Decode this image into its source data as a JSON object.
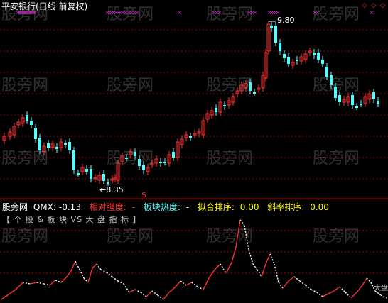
{
  "window": {
    "title": "平安银行(日线 前复权)",
    "controls": [
      "◇",
      "◇",
      "◇"
    ],
    "control_colors": [
      "#ff3333",
      "#ff3333",
      "#ff3333"
    ]
  },
  "price_chart": {
    "high_label": "9.80",
    "low_label": "←8.35",
    "dollar_marker": "$",
    "up_color": "#ff3232",
    "down_color": "#54ffff",
    "grid_color": "#a00000",
    "top_markers_color": "#ff33ff",
    "ma_color": "#ffffff"
  },
  "indicator": {
    "name": "股旁网",
    "items": [
      {
        "label": "QMX:",
        "value": "-0.13",
        "color": "#ffffff"
      },
      {
        "label": "相对强度:",
        "value": "-",
        "color": "#ff3333"
      },
      {
        "label": "板块热度:",
        "value": "-",
        "color": "#54ffff"
      },
      {
        "label": "拟合排序:",
        "value": "0.00",
        "color": "#ffff00"
      },
      {
        "label": "斜率排序:",
        "value": "0.00",
        "color": "#ffff00"
      }
    ],
    "subtitle": "【 个 股 & 板 块 VS 大 盘 指 标 】",
    "tail_tag": "大盘"
  },
  "watermark": "股旁网",
  "chart_data": {
    "type": "candlestick",
    "high": 9.8,
    "low": 8.35,
    "indicator_type": "line",
    "indicator_colors": {
      "rising": "#ff3333",
      "falling": "#ffffff"
    }
  }
}
